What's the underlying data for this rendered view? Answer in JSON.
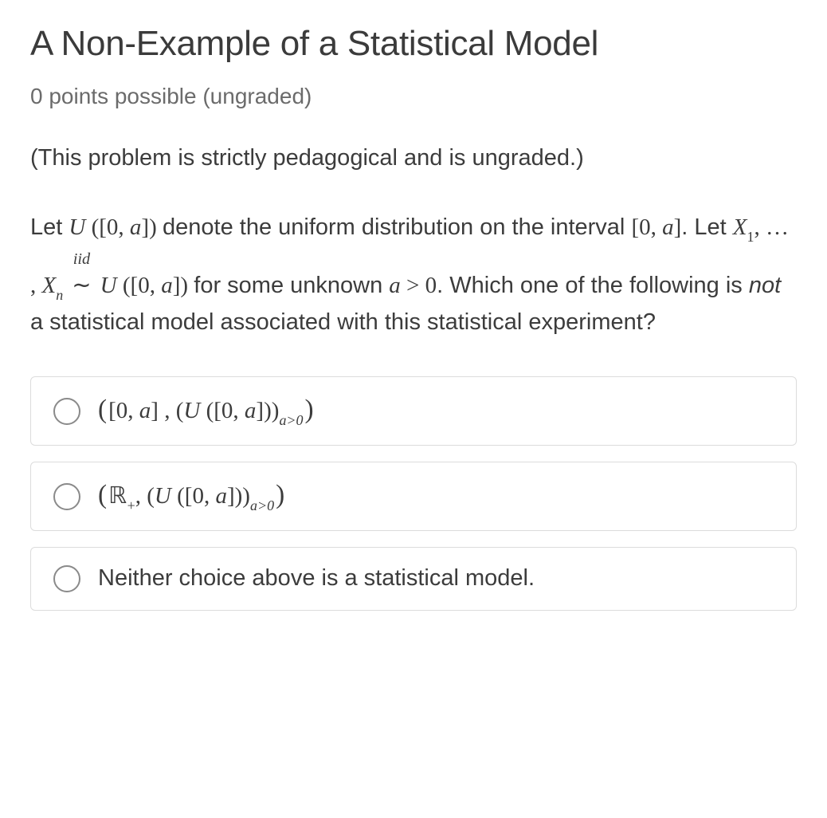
{
  "title": "A Non-Example of a Statistical Model",
  "subtitle": "0 points possible (ungraded)",
  "note": "(This problem is strictly pedagogical and is ungraded.)",
  "prompt": {
    "t1": "Let ",
    "cal_U": "U",
    "lp": " (",
    "lb": "[",
    "zero": "0",
    "comma": ", ",
    "a": "a",
    "rb": "]",
    "rp": ") ",
    "t2": "denote the uniform distribution on the interval ",
    "dot_let": ". Let ",
    "X": "X",
    "one": "1",
    "dots": ", … , ",
    "n": "n",
    "iid": "iid",
    "tilde": "∼",
    "for_some": " for some unknown ",
    "gt0": " > 0",
    "t3": ". Which one of the following is ",
    "not": "not",
    "t4": " a statistical model associated with this statistical experiment?"
  },
  "options": {
    "a": {
      "bl": "(",
      "lb": "[",
      "zero": "0",
      "comma": ", ",
      "a": "a",
      "rb": "]",
      "c2": " , ",
      "lp2": "(",
      "cal_U": "U",
      "sp": " ",
      "lp3": "(",
      "rp3": ")",
      "rp2": ")",
      "sub": "a>0",
      "br": ")"
    },
    "b": {
      "bl": "(",
      "Rpos": "ℝ",
      "plus": "+",
      "c2": ", ",
      "lp2": "(",
      "cal_U": "U",
      "sp": " ",
      "lp3": "(",
      "lb": "[",
      "zero": "0",
      "comma": ", ",
      "a": "a",
      "rb": "]",
      "rp3": ")",
      "rp2": ")",
      "sub": "a>0",
      "br": ")"
    },
    "c": {
      "text": "Neither choice above is a statistical model."
    }
  }
}
